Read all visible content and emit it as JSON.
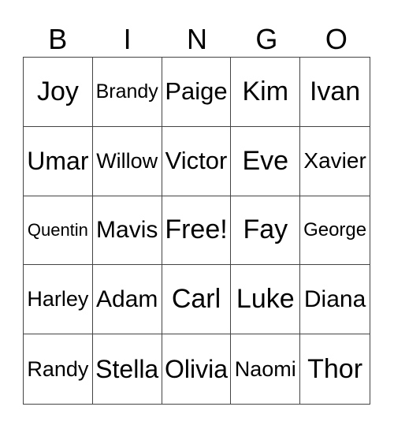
{
  "header": [
    "B",
    "I",
    "N",
    "G",
    "O"
  ],
  "cells": [
    "Joy",
    "Brandy",
    "Paige",
    "Kim",
    "Ivan",
    "Umar",
    "Willow",
    "Victor",
    "Eve",
    "Xavier",
    "Quentin",
    "Mavis",
    "Free!",
    "Fay",
    "George",
    "Harley",
    "Adam",
    "Carl",
    "Luke",
    "Diana",
    "Randy",
    "Stella",
    "Olivia",
    "Naomi",
    "Thor"
  ]
}
